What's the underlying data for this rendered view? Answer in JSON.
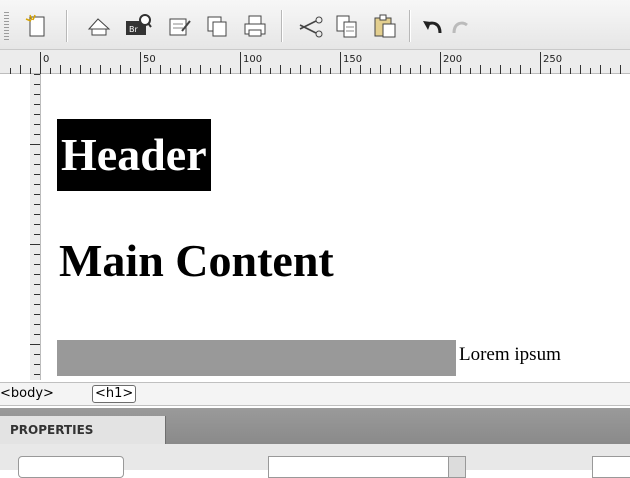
{
  "toolbar": {
    "buttons": [
      "new-document-icon",
      "edit-icon",
      "bridge-search-icon",
      "check-in-icon",
      "copy-page-icon",
      "print-icon",
      "cut-icon",
      "copy-icon",
      "paste-icon",
      "undo-icon",
      "redo-icon"
    ]
  },
  "ruler": {
    "labels": [
      "0",
      "50",
      "100",
      "150",
      "200",
      "250"
    ]
  },
  "canvas": {
    "header_text": "Header",
    "main_heading": "Main Content",
    "lorem_text": "Lorem ipsum"
  },
  "tag_selector": {
    "body_tag": "<body>",
    "h1_tag": "<h1>"
  },
  "panel": {
    "tab_label": "PROPERTIES"
  },
  "colors": {
    "header_bg": "#000000",
    "gray_bar": "#999999",
    "panel_header": "#8f8f8f"
  }
}
